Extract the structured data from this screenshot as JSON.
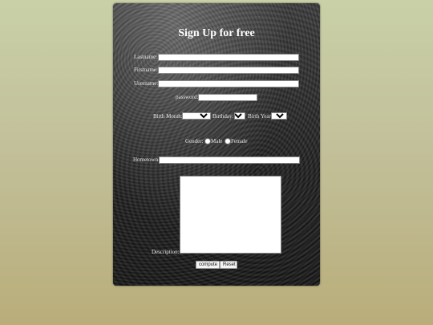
{
  "form": {
    "title": "Sign Up for free",
    "lastname_label": "Lastname:",
    "firstname_label": "Firstname:",
    "username_label": "Username:",
    "password_label": "password:",
    "birth_month_label": "Birth Month:",
    "birthday_label": "Birthday:",
    "birth_year_label": "Birth Year:",
    "gender_label": "Gender:",
    "gender_male_label": "Male",
    "gender_female_label": "Female",
    "hometown_label": "Hometown:",
    "description_label": "Description:",
    "compute_button": "compute",
    "reset_button": "Reset"
  }
}
